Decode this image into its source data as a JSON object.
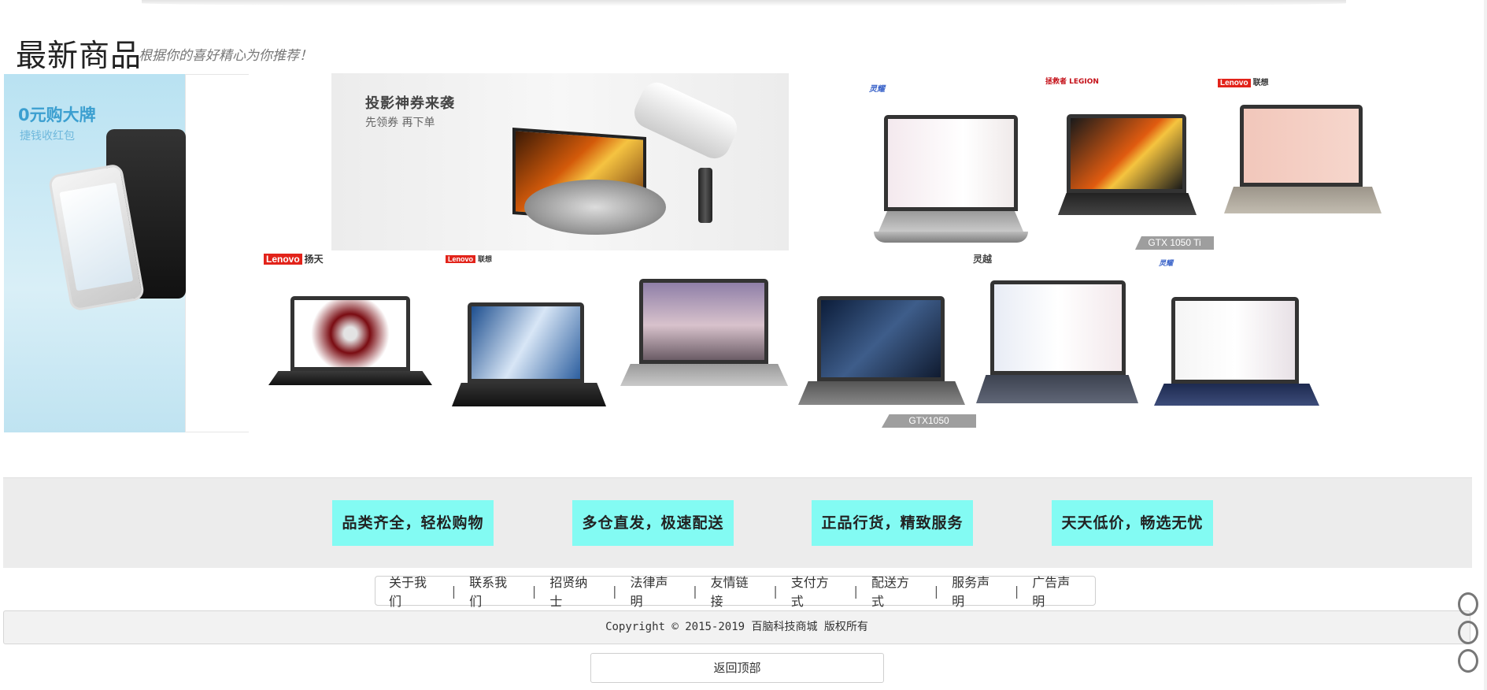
{
  "section": {
    "title": "最新商品",
    "subtitle": "根据你的喜好精心为你推荐！"
  },
  "promo_left": {
    "title": "0元购大牌",
    "subtitle": "捷钱收红包"
  },
  "promo_projector": {
    "title": "投影神券来袭",
    "subtitle": "先领券 再下单"
  },
  "laptops": [
    {
      "brand": "灵耀",
      "tag": ""
    },
    {
      "brand": "拯救者 LEGION",
      "tag": "GTX 1050 Ti"
    },
    {
      "brand_box": "Lenovo",
      "brand": "联想",
      "tag": ""
    },
    {
      "brand_box": "Lenovo",
      "brand": "扬天",
      "tag": ""
    },
    {
      "brand_box": "Lenovo",
      "brand": "联想",
      "tag": ""
    },
    {
      "brand": "",
      "tag": ""
    },
    {
      "brand": "",
      "tag": "GTX1050"
    },
    {
      "brand": "灵越",
      "tag": ""
    },
    {
      "brand": "灵耀",
      "tag": ""
    }
  ],
  "features": [
    "品类齐全，轻松购物",
    "多仓直发，极速配送",
    "正品行货，精致服务",
    "天天低价，畅选无忧"
  ],
  "footer_links": [
    "关于我们",
    "联系我们",
    "招贤纳士",
    "法律声明",
    "友情链接",
    "支付方式",
    "配送方式",
    "服务声明",
    "广告声明"
  ],
  "footer_separator": "|",
  "copyright": "Copyright © 2015-2019 百脑科技商城 版权所有",
  "back_to_top": "返回顶部",
  "colors": {
    "feature_bg": "#83fbf3",
    "strip_bg": "#ececec"
  }
}
